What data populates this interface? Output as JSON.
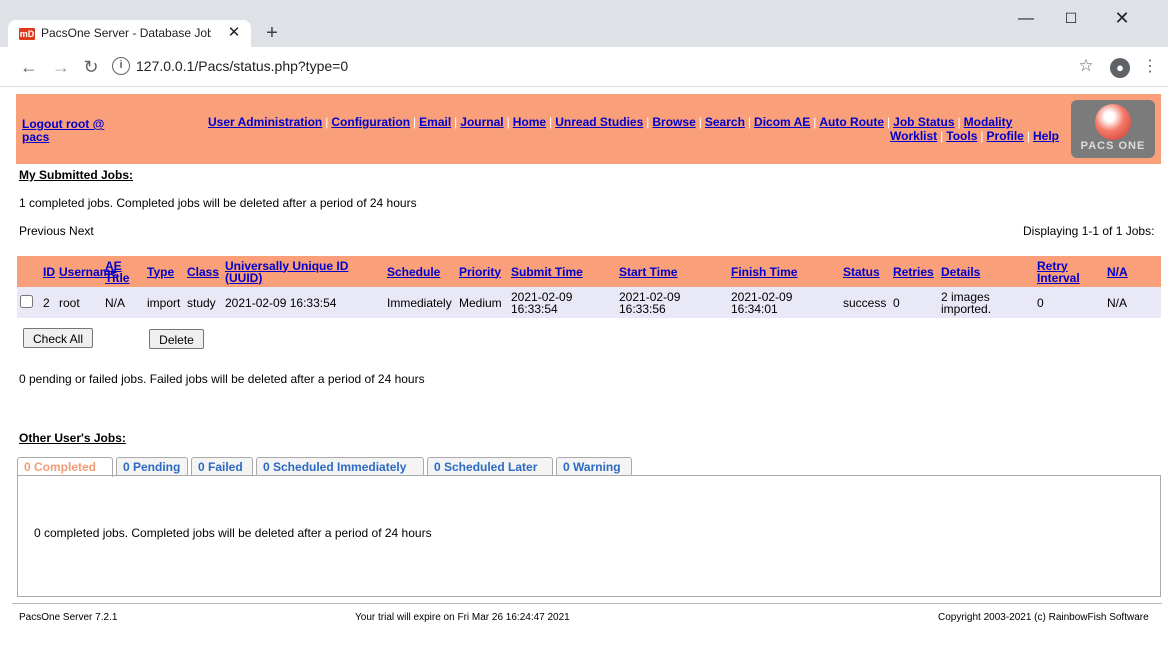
{
  "browser": {
    "tab_title": "PacsOne Server - Database Job S",
    "favicon_text": "mD",
    "url": "127.0.0.1/Pacs/status.php?type=0"
  },
  "header": {
    "logout_label": "Logout root @ pacs",
    "nav_row1": [
      "User Administration",
      "Configuration",
      "Email",
      "Journal",
      "Home",
      "Unread Studies",
      "Browse",
      "Search",
      "Dicom AE",
      "Auto Route",
      "Job Status",
      "Modality"
    ],
    "nav_row2": [
      "Worklist",
      "Tools",
      "Profile",
      "Help"
    ],
    "logo_text": "PACS ONE"
  },
  "my_jobs": {
    "title": "My Submitted Jobs:",
    "completed_note": "1 completed jobs. Completed jobs will be deleted after a period of 24 hours",
    "prev_next": "Previous Next",
    "displaying": "Displaying 1-1 of 1 Jobs:",
    "columns": [
      "ID",
      "Username",
      "AE Title",
      "Type",
      "Class",
      "Universally Unique ID (UUID)",
      "Schedule",
      "Priority",
      "Submit Time",
      "Start Time",
      "Finish Time",
      "Status",
      "Retries",
      "Details",
      "Retry Interval",
      "N/A"
    ],
    "rows": [
      [
        "2",
        "root",
        "N/A",
        "import",
        "study",
        "2021-02-09 16:33:54",
        "Immediately",
        "Medium",
        "2021-02-09 16:33:54",
        "2021-02-09 16:33:56",
        "2021-02-09 16:34:01",
        "success",
        "0",
        "2 images imported.",
        "0",
        "N/A"
      ]
    ],
    "check_all": "Check All",
    "delete": "Delete",
    "pending_note": "0 pending or failed jobs. Failed jobs will be deleted after a period of 24 hours"
  },
  "other_jobs": {
    "title": "Other User's Jobs:",
    "tabs": [
      "0 Completed",
      "0 Pending",
      "0 Failed",
      "0 Scheduled Immediately",
      "0 Scheduled Later",
      "0 Warning"
    ],
    "panel_note": "0 completed jobs. Completed jobs will be deleted after a period of 24 hours"
  },
  "footer": {
    "version": "PacsOne Server 7.2.1",
    "trial": "Your trial will expire on Fri Mar 26 16:24:47 2021",
    "copyright": "Copyright 2003-2021 (c) RainbowFish Software"
  }
}
